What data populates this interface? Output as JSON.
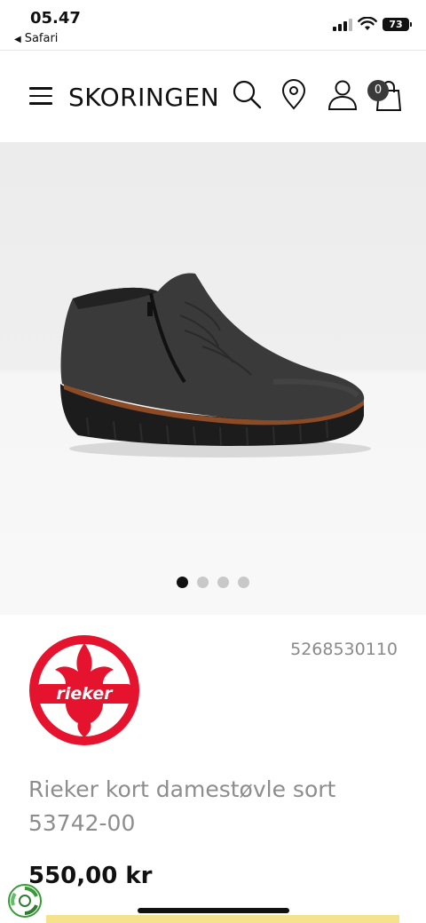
{
  "status": {
    "time": "05.47",
    "back_label": "Safari",
    "battery": "73"
  },
  "header": {
    "brand": "SKORINGEN",
    "cart_count": "0"
  },
  "gallery": {
    "image_alt": "black ankle boot with side zipper and wedge sole",
    "dots_total": 4,
    "active_dot": 1
  },
  "product": {
    "brand_logo_text": "rieker",
    "sku": "5268530110",
    "title_line1": "Rieker kort damestøvle sort",
    "title_line2": "53742-00",
    "price": "550,00 kr"
  },
  "colors": {
    "brand_red": "#e5132e",
    "accent_yellow": "#f4e38c"
  }
}
